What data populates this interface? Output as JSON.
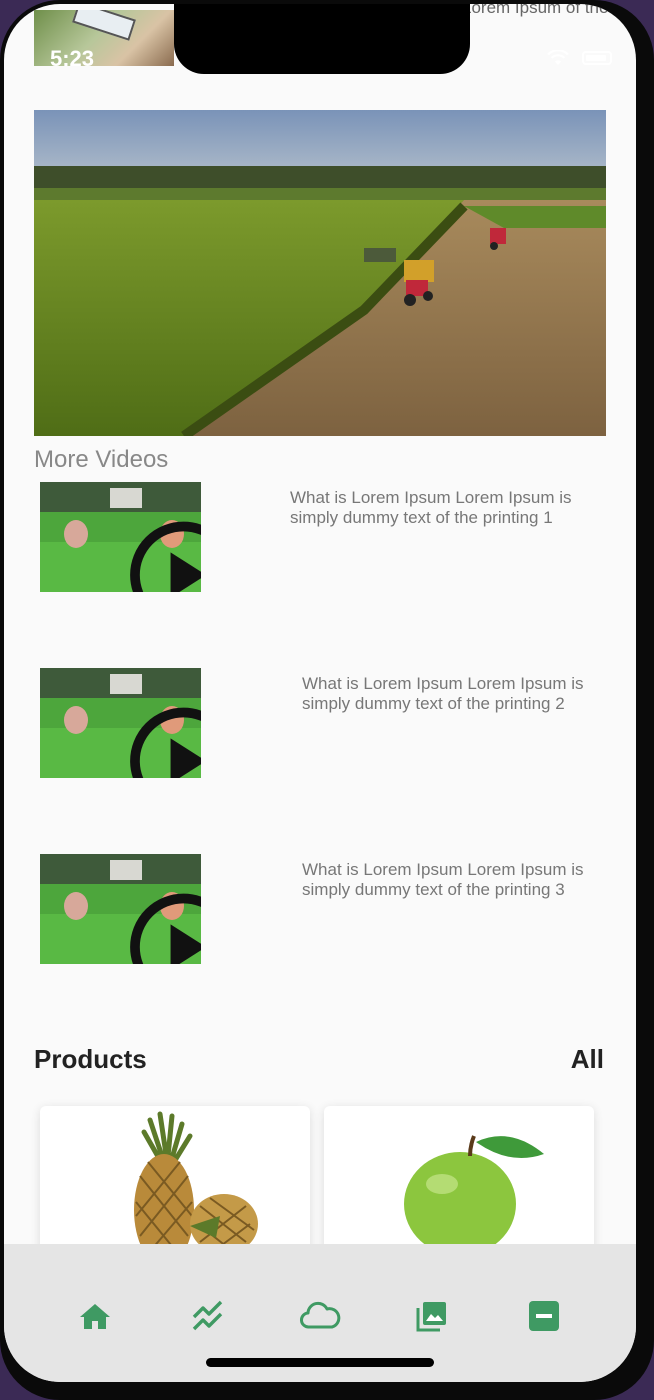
{
  "status_bar": {
    "time": "5:23"
  },
  "peek": {
    "text": "Lorem Ipsum of the"
  },
  "videos_section": {
    "title": "More Videos",
    "items": [
      {
        "text": "What is Lorem Ipsum Lorem Ipsum is simply dummy text of the printing 1"
      },
      {
        "text": "What is Lorem Ipsum Lorem Ipsum is simply dummy text of the printing 2"
      },
      {
        "text": "What is Lorem Ipsum Lorem Ipsum is simply dummy text of the printing 3"
      }
    ]
  },
  "products_section": {
    "title": "Products",
    "all_label": "All",
    "items": [
      {
        "image_icon": "pineapple-image"
      },
      {
        "image_icon": "green-apple-image"
      }
    ]
  },
  "bottom_nav": {
    "accent_color": "#3f9a63",
    "items": [
      {
        "icon": "home-icon"
      },
      {
        "icon": "trending-icon"
      },
      {
        "icon": "cloud-icon"
      },
      {
        "icon": "gallery-icon"
      },
      {
        "icon": "minus-box-icon"
      }
    ]
  }
}
